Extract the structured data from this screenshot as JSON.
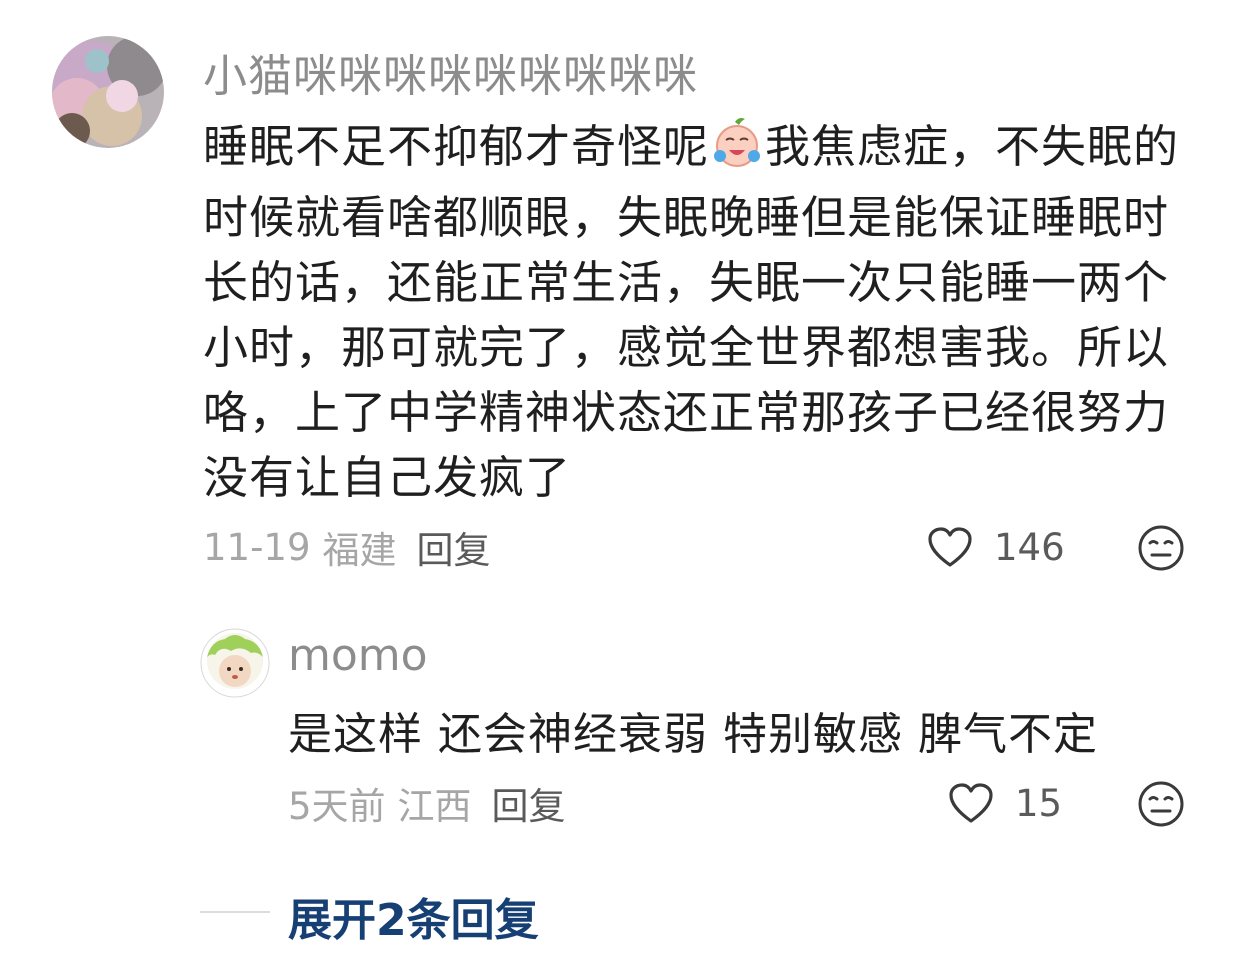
{
  "comment": {
    "username": "小猫咪咪咪咪咪咪咪咪咪",
    "text_before_emoji": "睡眠不足不抑郁才奇怪呢",
    "emoji": "crying-face-emoji",
    "text_after_emoji": "我焦虑症，不失眠的时候就看啥都顺眼，失眠晚睡但是能保证睡眠时长的话，还能正常生活，失眠一次只能睡一两个小时，那可就完了，感觉全世界都想害我。所以咯，上了中学精神状态还正常那孩子已经很努力没有让自己发疯了",
    "date": "11-19",
    "location": "福建",
    "reply_label": "回复",
    "likes": "146"
  },
  "reply": {
    "username": "momo",
    "text": "是这样 还会神经衰弱 特别敏感 脾气不定",
    "date": "5天前",
    "location": "江西",
    "reply_label": "回复",
    "likes": "15"
  },
  "expand_replies": {
    "label": "展开2条回复"
  },
  "colors": {
    "username": "#8c8c8c",
    "body_text": "#1f1f1f",
    "meta_text": "#a6a6a6",
    "action_text": "#5a5a5a",
    "expand_link": "#163f73"
  }
}
